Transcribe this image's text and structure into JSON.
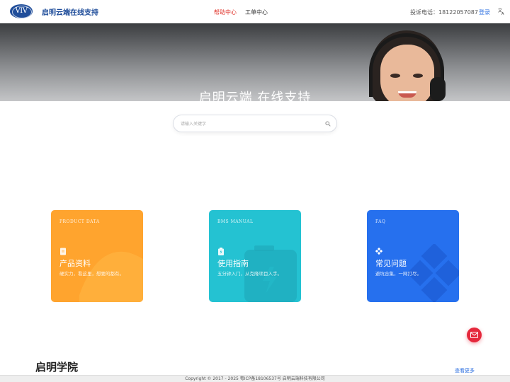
{
  "header": {
    "logo_text": "VIV",
    "brand": "启明云端在线支持",
    "nav": [
      {
        "label": "帮助中心",
        "active": true
      },
      {
        "label": "工单中心",
        "active": false
      }
    ],
    "phone": "投诉电话：18122057087",
    "login": "登录",
    "lang_icon": "文A"
  },
  "hero": {
    "title": "启明云端 在线支持"
  },
  "search": {
    "placeholder": "请输入关键字",
    "icon": "search-icon"
  },
  "cards": [
    {
      "subtitle": "PRODUCT DATA",
      "title": "产品资料",
      "desc": "硬实力，看这里，想要的都有。",
      "color": "#ffa42e",
      "icon": "document-icon"
    },
    {
      "subtitle": "BMS MANUAL",
      "title": "使用指南",
      "desc": "五分钟入门，从克隆项目入手。",
      "color": "#24c2d2",
      "icon": "battery-icon"
    },
    {
      "subtitle": "FAQ",
      "title": "常见问题",
      "desc": "避坑合集，一网打尽。",
      "color": "#2670ee",
      "icon": "diamond-icon"
    }
  ],
  "academy": {
    "title": "启明学院",
    "more": "查看更多"
  },
  "footer": {
    "copyright": "Copyright © 2017 - 2025 粤ICP备18106537号 启明云端科技有限公司"
  },
  "colors": {
    "accent": "#2a6ee0",
    "brand": "#1f4d9a",
    "active_nav": "#e0342b",
    "fab": "#e5283c"
  }
}
